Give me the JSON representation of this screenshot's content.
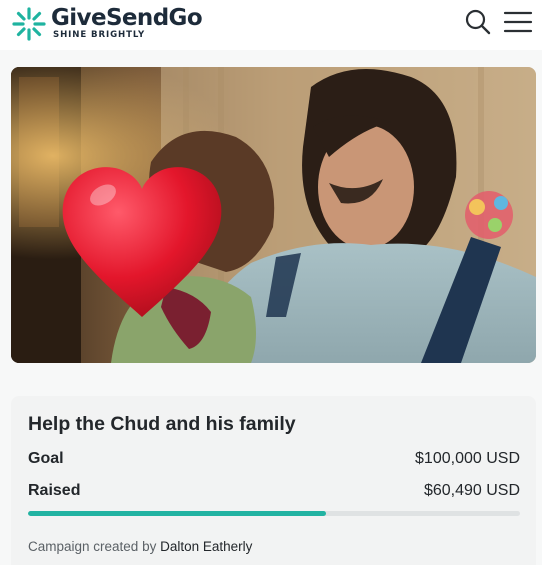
{
  "header": {
    "brand_main": "GiveSendGo",
    "tagline": "SHINE BRIGHTLY",
    "icons": {
      "search": "search-icon",
      "menu": "hamburger-menu-icon"
    },
    "colors": {
      "brand_teal": "#1fb3a0",
      "brand_dark": "#1d2b3a"
    }
  },
  "hero": {
    "overlay_icon": "red-heart-emoji"
  },
  "campaign": {
    "title": "Help the Chud and his family",
    "goal_label": "Goal",
    "goal_value": "$100,000 USD",
    "raised_label": "Raised",
    "raised_value": "$60,490 USD",
    "progress_fraction": 0.6049,
    "creator_prefix": "Campaign created by",
    "creator_name": "Dalton Eatherly",
    "colors": {
      "progress": "#22b3a2",
      "track": "#dfe2e3"
    }
  }
}
